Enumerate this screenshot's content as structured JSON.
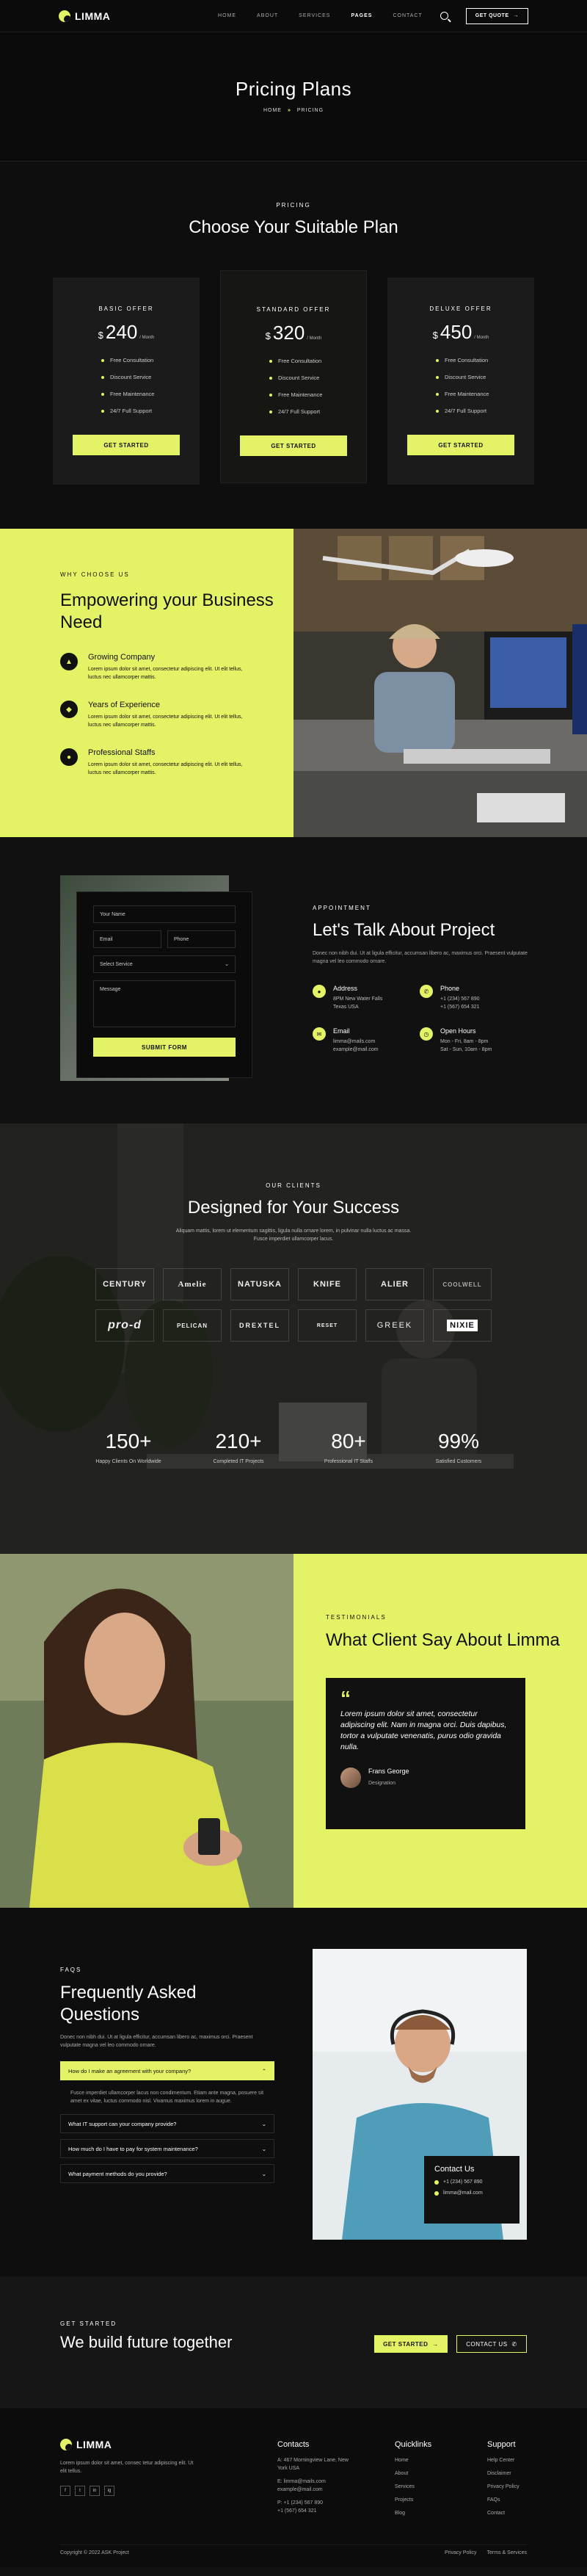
{
  "nav": {
    "brand": "LIMMA",
    "menu": [
      "HOME",
      "ABOUT",
      "SERVICES",
      "PAGES",
      "CONTACT"
    ],
    "active": "PAGES",
    "quote_label": "GET QUOTE"
  },
  "hero": {
    "title": "Pricing Plans",
    "crumb_home": "HOME",
    "crumb_sep": "»",
    "crumb_current": "PRICING"
  },
  "pricing": {
    "label": "PRICING",
    "title": "Choose Your Suitable Plan",
    "plans": [
      {
        "name": "BASIC OFFER",
        "currency": "$",
        "price": "240",
        "per": "/ Month",
        "features": [
          "Free Consultation",
          "Discount Service",
          "Free Maintenance",
          "24/7 Full Support"
        ],
        "button": "GET STARTED"
      },
      {
        "name": "STANDARD OFFER",
        "currency": "$",
        "price": "320",
        "per": "/ Month",
        "features": [
          "Free Consultation",
          "Discount Service",
          "Free Maintenance",
          "24/7 Full Support"
        ],
        "button": "GET STARTED"
      },
      {
        "name": "DELUXE OFFER",
        "currency": "$",
        "price": "450",
        "per": "/ Month",
        "features": [
          "Free Consultation",
          "Discount Service",
          "Free Maintenance",
          "24/7 Full Support"
        ],
        "button": "GET STARTED"
      }
    ]
  },
  "why": {
    "label": "WHY CHOOSE US",
    "title": "Empowering your Business Need",
    "items": [
      {
        "title": "Growing Company",
        "text": "Lorem ipsum dolor sit amet, consectetur adipiscing elit. Ut elit tellus, luctus nec ullamcorper mattis."
      },
      {
        "title": "Years of Experience",
        "text": "Lorem ipsum dolor sit amet, consectetur adipiscing elit. Ut elit tellus, luctus nec ullamcorper mattis."
      },
      {
        "title": "Professional Staffs",
        "text": "Lorem ipsum dolor sit amet, consectetur adipiscing elit. Ut elit tellus, luctus nec ullamcorper mattis."
      }
    ]
  },
  "contact": {
    "form": {
      "name": "Your Name",
      "email": "Email",
      "phone": "Phone",
      "service": "Select Service",
      "message": "Message",
      "submit": "SUBMIT FORM"
    },
    "label": "APPOINTMENT",
    "title": "Let's Talk About Project",
    "lead": "Donec non nibh dui. Ut at ligula efficitur, accumsan libero ac, maximus orci. Praesent vulputate magna vel leo commodo ornare.",
    "address": {
      "title": "Address",
      "lines": [
        "8PM New Water Falls",
        "Texas USA"
      ]
    },
    "phone": {
      "title": "Phone",
      "lines": [
        "+1 (234) 567 890",
        "+1 (567) 654 321"
      ]
    },
    "email": {
      "title": "Email",
      "lines": [
        "limma@mails.com",
        "example@mail.com"
      ]
    },
    "hours": {
      "title": "Open Hours",
      "lines": [
        "Mon - Fri, 8am - 8pm",
        "Sat - Sun, 10am - 8pm"
      ]
    }
  },
  "clients": {
    "label": "OUR CLIENTS",
    "title": "Designed for Your Success",
    "lead": "Aliquam mattis, lorem ut elementum sagittis, ligula nulla ornare lorem, in pulvinar nulla luctus ac massa. Fusce imperdiet ullamcorper lacus.",
    "logos": [
      "CENTURY",
      "Amelie",
      "NATUSKA",
      "KNIFE",
      "ALIER",
      "COOLWELL",
      "pro-d",
      "PELICAN",
      "DREXTEL",
      "RESET",
      "GREEK",
      "NIXIE"
    ],
    "stats": [
      {
        "value": "150+",
        "label": "Happy Clients On Worldwide"
      },
      {
        "value": "210+",
        "label": "Completed IT Projects"
      },
      {
        "value": "80+",
        "label": "Professional IT Staffs"
      },
      {
        "value": "99%",
        "label": "Satisfied Customers"
      }
    ]
  },
  "testimonials": {
    "label": "TESTIMONIALS",
    "title": "What Client Say About Limma",
    "quote": "Lorem ipsum dolor sit amet, consectetur adipiscing elit. Nam in magna orci. Duis dapibus, tortor a vulputate venenatis, purus odio gravida nulla.",
    "author": "Frans George",
    "role": "Designation"
  },
  "faq": {
    "label": "FAQS",
    "title": "Frequently Asked Questions",
    "lead": "Donec non nibh dui. Ut at ligula efficitur, accumsan libero ac, maximus orci. Praesent vulputate magna vel leo commodo ornare.",
    "open_q": "How do I make an agreement with your company?",
    "open_a": "Fusce imperdiet ullamcorper lacus non condimentum. Etiam ante magna, posuere sit amet ex vitae, luctus commodo nisl. Vivamus maximus lorem in augue.",
    "questions": [
      "What IT support can your company provide?",
      "How much do I have to pay for system maintenance?",
      "What payment methods do you provide?"
    ],
    "help_title": "Contact Us",
    "help_phone": "+1 (234) 567 890",
    "help_email": "limma@mail.com"
  },
  "cta": {
    "label": "GET STARTED",
    "title": "We build future together",
    "primary": "GET STARTED",
    "secondary": "CONTACT US"
  },
  "footer": {
    "brand": "LIMMA",
    "about": "Lorem ipsum dolor sit amet, consec tetur adipiscing elit. Ut elit tellus.",
    "socials": [
      "f",
      "t",
      "in",
      "ig"
    ],
    "contacts_title": "Contacts",
    "contacts": [
      "A: 467 Morningview Lane, New York USA",
      "E: limma@mails.com",
      "example@mail.com",
      "P: +1 (234) 567 890",
      "+1 (567) 654 321"
    ],
    "quick_title": "Quicklinks",
    "quick": [
      "Home",
      "About",
      "Services",
      "Projects",
      "Blog"
    ],
    "support_title": "Support",
    "support": [
      "Help Center",
      "Disclaimer",
      "Privacy Policy",
      "FAQs",
      "Contact"
    ],
    "copyright": "Copyright © 2022 ASK Project",
    "links": [
      "Privacy Policy",
      "Terms & Services"
    ]
  }
}
